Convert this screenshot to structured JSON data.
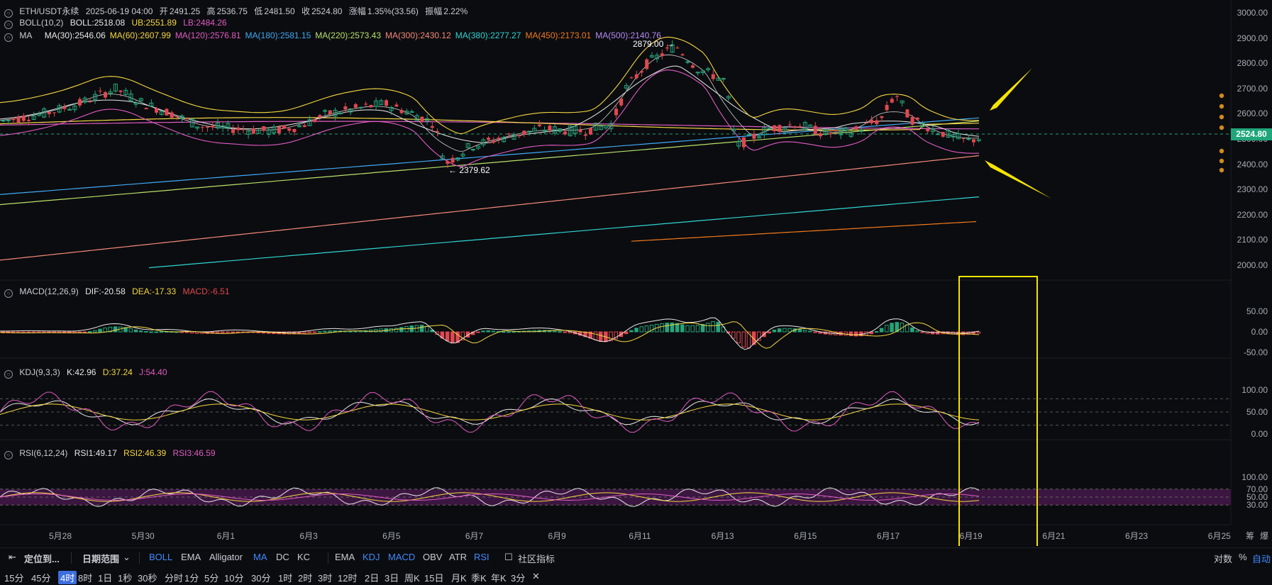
{
  "header": {
    "symbol": "ETH/USDT永续",
    "datetime": "2025-06-19 04:00",
    "open_label": "开",
    "open": "2491.25",
    "high_label": "高",
    "high": "2536.75",
    "low_label": "低",
    "low": "2481.50",
    "close_label": "收",
    "close": "2524.80",
    "change_label": "涨幅",
    "change": "1.35%(33.56)",
    "amp_label": "振幅",
    "amp": "2.22%"
  },
  "boll": {
    "name": "BOLL(10,2)",
    "boll": "BOLL:2518.08",
    "ub": "UB:2551.89",
    "lb": "LB:2484.26",
    "colors": {
      "boll": "#e8e8e8",
      "ub": "#f5d742",
      "lb": "#e05bc4"
    }
  },
  "ma": {
    "name": "MA",
    "items": [
      {
        "text": "MA(30):2546.06",
        "color": "#e8e8e8"
      },
      {
        "text": "MA(60):2607.99",
        "color": "#f5d742"
      },
      {
        "text": "MA(120):2576.81",
        "color": "#e05bc4"
      },
      {
        "text": "MA(180):2581.15",
        "color": "#3fa9f5"
      },
      {
        "text": "MA(220):2573.43",
        "color": "#b8e06a"
      },
      {
        "text": "MA(300):2430.12",
        "color": "#f58a7a"
      },
      {
        "text": "MA(380):2277.27",
        "color": "#2fd4d4"
      },
      {
        "text": "MA(450):2173.01",
        "color": "#f27b1d"
      },
      {
        "text": "MA(500):2140.76",
        "color": "#b58cf5"
      }
    ]
  },
  "annotations": {
    "high_marker": "2879.00",
    "low_marker": "2379.62"
  },
  "price_axis": {
    "ticks": [
      "3000.00",
      "2900.00",
      "2800.00",
      "2700.00",
      "2600.00",
      "2500.00",
      "2400.00",
      "2300.00",
      "2200.00",
      "2100.00",
      "2000.00"
    ],
    "last_price": "2524.80"
  },
  "macd": {
    "name": "MACD(12,26,9)",
    "dif": "DIF:-20.58",
    "dea": "DEA:-17.33",
    "macd": "MACD:-6.51",
    "ticks": [
      "50.00",
      "0.00",
      "-50.00"
    ]
  },
  "kdj": {
    "name": "KDJ(9,3,3)",
    "k": "K:42.96",
    "d": "D:37.24",
    "j": "J:54.40",
    "ticks": [
      "100.00",
      "50.00",
      "0.00"
    ]
  },
  "rsi": {
    "name": "RSI(6,12,24)",
    "rsi1": "RSI1:49.17",
    "rsi2": "RSI2:46.39",
    "rsi3": "RSI3:46.59",
    "ticks": [
      "100.00",
      "70.00",
      "50.00",
      "30.00"
    ]
  },
  "xaxis": {
    "labels": [
      "5月28",
      "5月30",
      "6月1",
      "6月3",
      "6月5",
      "6月7",
      "6月9",
      "6月11",
      "6月13",
      "6月15",
      "6月17",
      "6月19",
      "6月21",
      "6月23",
      "6月25"
    ],
    "corner1": "筹",
    "corner2": "爆"
  },
  "toolbar1": {
    "locate": "定位到...",
    "date_range": "日期范围",
    "main_indicators": [
      "BOLL",
      "EMA",
      "Alligator",
      "MA",
      "DC",
      "KC"
    ],
    "sub_indicators": [
      "EMA",
      "KDJ",
      "MACD",
      "OBV",
      "ATR",
      "RSI"
    ],
    "community": "社区指标",
    "right": [
      "对数",
      "%",
      "自动"
    ]
  },
  "toolbar2": {
    "timeframes": [
      "15分",
      "45分",
      "4时",
      "8时",
      "1日",
      "1秒",
      "30秒",
      "分时",
      "1分",
      "5分",
      "10分",
      "30分",
      "1时",
      "2时",
      "3时",
      "12时",
      "2日",
      "3日",
      "周K",
      "15日",
      "月K",
      "季K",
      "年K",
      "3分"
    ],
    "active": "4时",
    "close": "✕"
  },
  "colors": {
    "up": "#26a47a",
    "down": "#e0484f",
    "highlight": "#f5e400",
    "rsi_band": "#3b1640",
    "bg": "#0b0c0f"
  }
}
